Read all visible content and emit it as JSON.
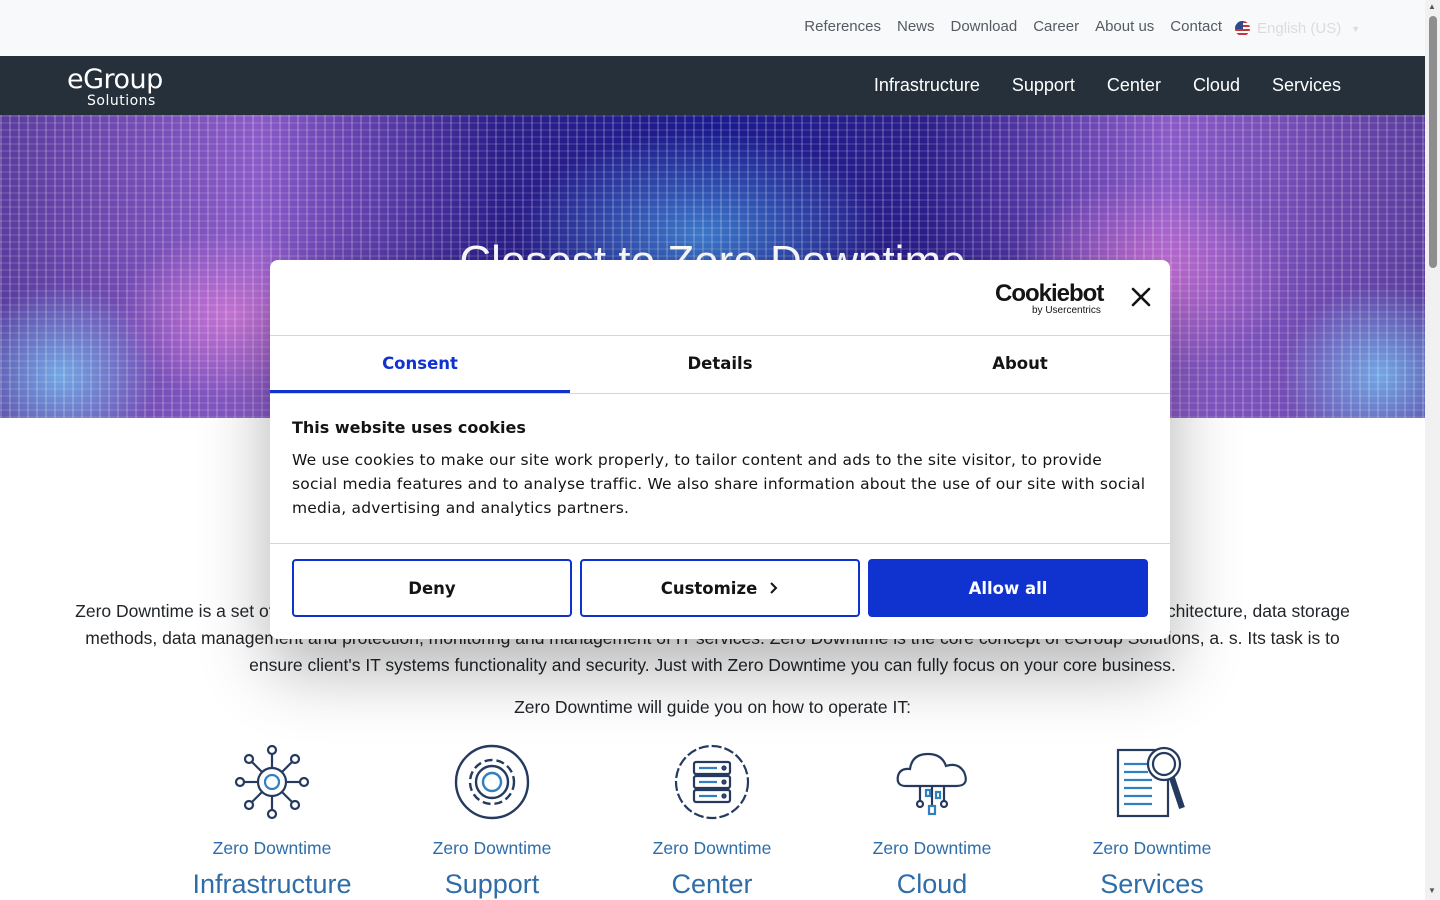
{
  "topbar": {
    "links": [
      "References",
      "News",
      "Download",
      "Career",
      "About us",
      "Contact"
    ],
    "language": "English (US)"
  },
  "navbar": {
    "logo_line1": "eGroup",
    "logo_line2": "Solutions",
    "items": [
      "Infrastructure",
      "Support",
      "Center",
      "Cloud",
      "Services"
    ]
  },
  "hero": {
    "title": "Closest to Zero Downtime"
  },
  "content": {
    "intro": "Zero Downtime is a set of methods and procedures which guarantee the highest possible availability. It consists of design of a functional IT architecture, data storage methods, data management and protection, monitoring and management of IT services. Zero Downtime is the core concept of eGroup Solutions, a. s. Its task is to ensure client's IT systems functionality and security. Just with Zero Downtime you can fully focus on your core business.",
    "guide": "Zero Downtime will guide you on how to operate IT:",
    "cards": [
      {
        "subtitle": "Zero Downtime",
        "title": "Infrastructure",
        "icon": "network-hub-icon"
      },
      {
        "subtitle": "Zero Downtime",
        "title": "Support",
        "icon": "gear-icon"
      },
      {
        "subtitle": "Zero Downtime",
        "title": "Center",
        "icon": "server-rack-icon"
      },
      {
        "subtitle": "Zero Downtime",
        "title": "Cloud",
        "icon": "cloud-icon"
      },
      {
        "subtitle": "Zero Downtime",
        "title": "Services",
        "icon": "document-search-icon"
      }
    ]
  },
  "cookie_dialog": {
    "logo_main": "Cookiebot",
    "logo_sub": "by Usercentrics",
    "tabs": [
      "Consent",
      "Details",
      "About"
    ],
    "active_tab": "Consent",
    "heading": "This website uses cookies",
    "text": "We use cookies to make our site work properly, to tailor content and ads to the site visitor, to provide social media features and to analyse traffic. We also share information about the use of our site with social media, advertising and analytics partners.",
    "buttons": {
      "deny": "Deny",
      "customize": "Customize",
      "allow_all": "Allow all"
    }
  },
  "colors": {
    "navbar_bg": "#25303b",
    "accent_blue": "#1032cf",
    "link_blue": "#2f6da9",
    "topbar_bg": "#f8f9fa"
  }
}
